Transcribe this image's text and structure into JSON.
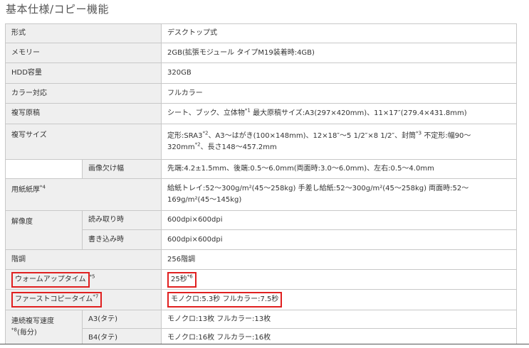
{
  "title": "基本仕様/コピー機能",
  "rows": {
    "format": {
      "label": "形式",
      "value": "デスクトップ式"
    },
    "memory": {
      "label": "メモリー",
      "value": "2GB(拡張モジュール タイプM19装着時:4GB)"
    },
    "hdd": {
      "label": "HDD容量",
      "value": "320GB"
    },
    "color": {
      "label": "カラー対応",
      "value": "フルカラー"
    },
    "original": {
      "label": "複写原稿",
      "value": "シート、ブック、立体物",
      "sup": "*1",
      "value2": "最大原稿サイズ:A3(297×420mm)、11×17″(279.4×431.8mm)"
    },
    "copy_size": {
      "label": "複写サイズ",
      "value": "定形:SRA3",
      "sup1": "*2",
      "value_b": "、A3〜はがき(100×148mm)、12×18″〜5 1/2″×8 1/2″、封筒",
      "sup2": "*3",
      "value_c": " 不定形:幅90〜320mm",
      "sup3": "*2",
      "value_d": "、長さ148〜457.2mm"
    },
    "image_loss": {
      "label": "画像欠け幅",
      "value": "先端:4.2±1.5mm、後端:0.5〜6.0mm(両面時:3.0〜6.0mm)、左右:0.5〜4.0mm"
    },
    "paper": {
      "label": "用紙紙厚",
      "sup": "*4",
      "value": "給紙トレイ:52〜300g/m²(45〜258kg) 手差し給紙:52〜300g/m²(45〜258kg) 両面時:52〜169g/m²(45〜145kg)"
    },
    "resolution": {
      "label": "解像度",
      "read_label": "読み取り時",
      "read_value": "600dpi×600dpi",
      "write_label": "書き込み時",
      "write_value": "600dpi×600dpi"
    },
    "gradation": {
      "label": "階調",
      "value": "256階調"
    },
    "warmup": {
      "label": "ウォームアップタイム",
      "sup": "*5",
      "value": "25秒",
      "value_sup": "*6"
    },
    "first_copy": {
      "label": "ファーストコピータイム",
      "sup": "*7",
      "value": "モノクロ:5.3秒 フルカラー:7.5秒"
    },
    "continuous": {
      "label": "連続複写速度",
      "label2": "(毎分)",
      "sup": "*8",
      "a3_label": "A3(タテ)",
      "a3_value": "モノクロ:13枚 フルカラー:13枚",
      "b4_label": "B4(タテ)",
      "b4_value": "モノクロ:16枚 フルカラー:16枚"
    }
  },
  "highlight_color": "#e02020",
  "header_bg": "#efefef"
}
